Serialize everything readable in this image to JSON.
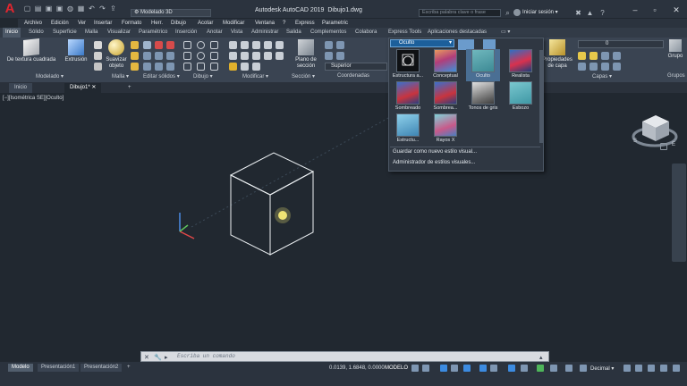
{
  "app": {
    "title": "Autodesk AutoCAD 2019",
    "document": "Dibujo1.dwg",
    "workspace": "Modelado 3D",
    "search_placeholder": "Escriba palabra clave o frase",
    "signin": "Iniciar sesión"
  },
  "menubar": [
    "Archivo",
    "Edición",
    "Ver",
    "Insertar",
    "Formato",
    "Herr.",
    "Dibujo",
    "Acotar",
    "Modificar",
    "Ventana",
    "?",
    "Express",
    "Parametric"
  ],
  "ribbon_tabs": [
    {
      "label": "Inicio",
      "active": true
    },
    {
      "label": "Sólido"
    },
    {
      "label": "Superficie"
    },
    {
      "label": "Malla"
    },
    {
      "label": "Visualizar"
    },
    {
      "label": "Paramétrico"
    },
    {
      "label": "Inserción"
    },
    {
      "label": "Anotar"
    },
    {
      "label": "Vista"
    },
    {
      "label": "Administrar"
    },
    {
      "label": "Salida"
    },
    {
      "label": "Complementos"
    },
    {
      "label": "Colabora"
    },
    {
      "label": "Express Tools"
    },
    {
      "label": "Aplicaciones destacadas"
    }
  ],
  "ribbon": {
    "buttons": {
      "box": "De textura cuadrada",
      "extrude": "Extrusión",
      "smooth": "Suavizar objeto",
      "section_plane": "Plano de sección",
      "layer_props": "Propiedades de capa",
      "group": "Grupo"
    },
    "groups": [
      "Modelado",
      "Malla",
      "Editar sólidos",
      "Dibujo",
      "Modificar",
      "Sección",
      "Coordenadas",
      "Capas",
      "Grupos"
    ],
    "coord_dropdown": "Superior",
    "layer_dropdown": "0"
  },
  "doc_tabs": [
    {
      "label": "Inicio"
    },
    {
      "label": "Dibujo1*",
      "active": true
    }
  ],
  "viewport_label": "[−][Isométrica SE][Oculto]",
  "visual_styles": {
    "current": "Oculto",
    "items": [
      {
        "label": "Estructura a...",
        "icon": "wireframe-2d-icon"
      },
      {
        "label": "Conceptual",
        "icon": "conceptual-icon"
      },
      {
        "label": "Oculto",
        "icon": "hidden-icon",
        "selected": true
      },
      {
        "label": "Realista",
        "icon": "realistic-icon"
      },
      {
        "label": "Sombreado",
        "icon": "shaded-icon"
      },
      {
        "label": "Sombrea...",
        "icon": "shaded-edges-icon"
      },
      {
        "label": "Tonos de gris",
        "icon": "shades-of-gray-icon"
      },
      {
        "label": "Esbozo",
        "icon": "sketchy-icon"
      },
      {
        "label": "Estructu...",
        "icon": "wireframe-icon"
      },
      {
        "label": "Rayos X",
        "icon": "xray-icon"
      }
    ],
    "links": [
      "Guardar como nuevo estilo visual...",
      "Administrador de estilos visuales..."
    ]
  },
  "command_line": {
    "placeholder": "Escriba un comando"
  },
  "layout_tabs": [
    {
      "label": "Modelo",
      "active": true
    },
    {
      "label": "Presentación1"
    },
    {
      "label": "Presentación2"
    }
  ],
  "status": {
    "coords": "0.0139, 1.6848, 0.0000",
    "space": "MODELO",
    "units": "Decimal"
  }
}
